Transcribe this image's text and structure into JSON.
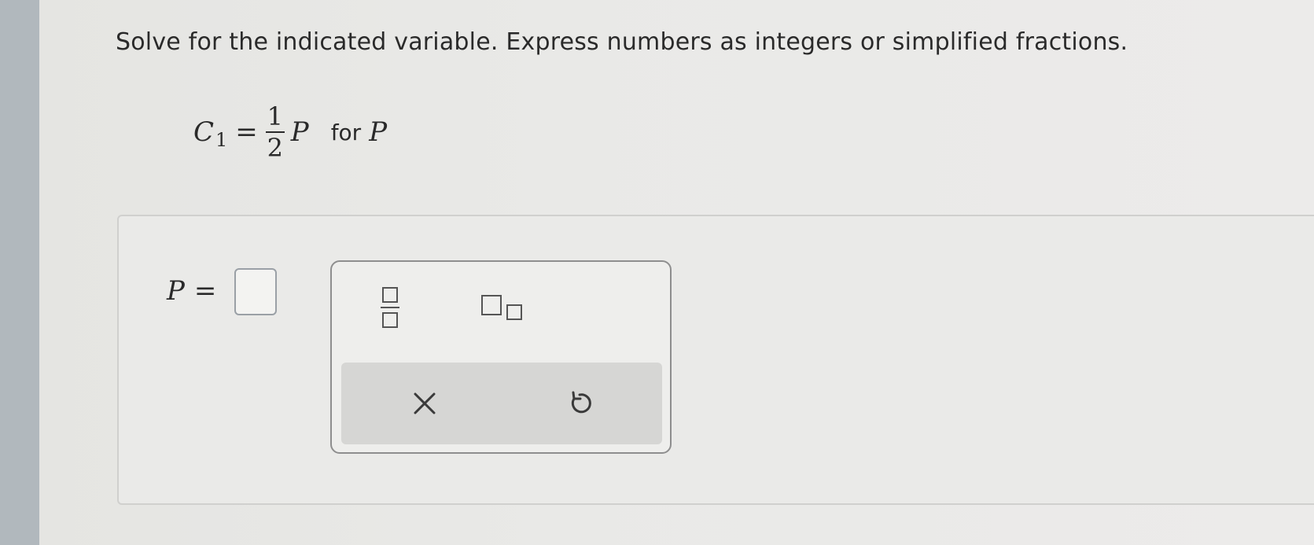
{
  "instruction": "Solve for the indicated variable. Express numbers as integers or simplified fractions.",
  "problem": {
    "lhs_var": "C",
    "lhs_sub": "1",
    "equals": "=",
    "frac_num": "1",
    "frac_den": "2",
    "rhs_var": "P",
    "for_word": "for",
    "solve_var": "P"
  },
  "answer": {
    "label_var": "P",
    "equals": "=",
    "value": ""
  },
  "toolbar": {
    "buttons": [
      "fraction-template",
      "subscript-template"
    ],
    "actions": [
      "clear",
      "undo"
    ]
  }
}
